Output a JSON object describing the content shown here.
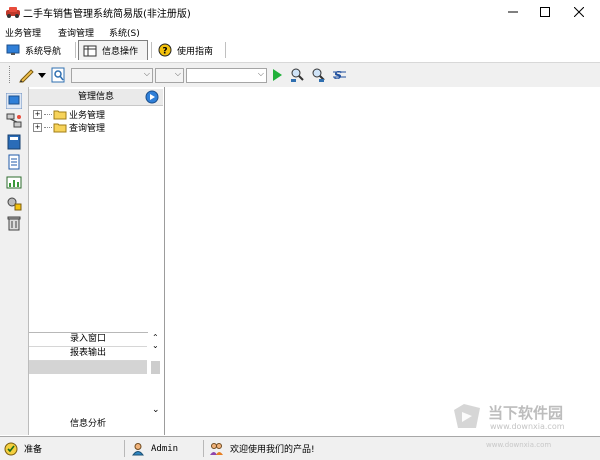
{
  "window": {
    "title": "二手车销售管理系统简易版(非注册版)",
    "minimize_glyph": "—",
    "maximize_glyph": "☐",
    "close_glyph": "✕"
  },
  "menu": {
    "items": [
      "业务管理",
      "查询管理",
      "系统(S)"
    ]
  },
  "tabs": [
    {
      "label": "系统导航",
      "icon": "monitor-icon"
    },
    {
      "label": "信息操作",
      "icon": "table-icon"
    },
    {
      "label": "使用指南",
      "icon": "help-icon"
    }
  ],
  "toolbar": {
    "icons": [
      "pencil-icon",
      "search-icon",
      "run-icon",
      "find-next-icon",
      "find-prev-icon",
      "sort-icon"
    ]
  },
  "side_panel": {
    "header": "管理信息",
    "tree": [
      {
        "label": "业务管理",
        "expander": "+"
      },
      {
        "label": "查询管理",
        "expander": "+"
      }
    ],
    "bottom_items": [
      "录入窗口",
      "报表输出",
      "",
      "信息分析"
    ]
  },
  "left_strip_icons": [
    "monitor-icon",
    "network-icon",
    "book-icon",
    "document-icon",
    "chart-icon",
    "settings-icon",
    "trash-icon"
  ],
  "status": {
    "ready": "准备",
    "user": "Admin",
    "message": "欢迎使用我们的产品!"
  },
  "watermark": {
    "brand": "当下软件园",
    "url": "www.downxia.com"
  },
  "colors": {
    "accent": "#1f6fc4",
    "selection": "#d4d4d4"
  }
}
